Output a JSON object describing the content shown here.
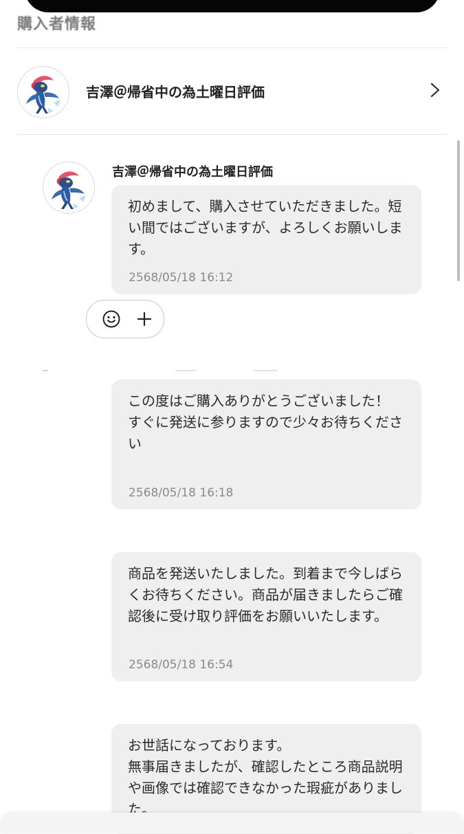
{
  "header": {
    "section_title": "購入者情報"
  },
  "buyer": {
    "name": "吉澤＠帰省中の為土曜日評価"
  },
  "messages": [
    {
      "sender": "吉澤＠帰省中の為土曜日評価",
      "text": "初めまして、購入させていただきました。短い間ではございますが、よろしくお願いします。",
      "time": "2568/05/18 16:12"
    },
    {
      "text": "この度はご購入ありがとうございました！\nすぐに発送に参りますので少々お待ちください",
      "time": "2568/05/18 16:18"
    },
    {
      "text": "商品を発送いたしました。到着まで今しばらくお待ちください。商品が届きましたらご確認後に受け取り評価をお願いいたします。",
      "time": "2568/05/18 16:54"
    },
    {
      "text": "お世話になっております。\n無事届きましたが、確認したところ商品説明や画像では確認できなかった瑕疵がありました。"
    }
  ],
  "icons": {
    "chevron": "chevron-right-icon",
    "smile": "smile-icon",
    "plus": "plus-icon",
    "avatar": "character-avatar"
  },
  "colors": {
    "bubble": "#efefef",
    "timestamp": "#8a8a8a",
    "text": "#222222"
  }
}
